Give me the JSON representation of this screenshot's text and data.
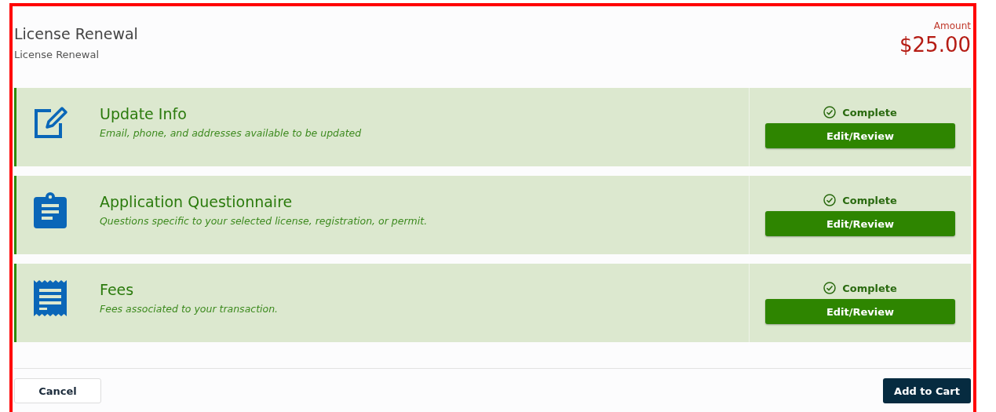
{
  "header": {
    "title": "License Renewal",
    "subtitle": "License Renewal",
    "amount_label": "Amount",
    "amount": "$25.00"
  },
  "steps": [
    {
      "kind": "edit",
      "title": "Update Info",
      "description": "Email, phone, and addresses available to be updated",
      "status": "Complete",
      "action": "Edit/Review"
    },
    {
      "kind": "clipboard",
      "title": "Application Questionnaire",
      "description": "Questions specific to your selected license, registration, or permit.",
      "status": "Complete",
      "action": "Edit/Review"
    },
    {
      "kind": "receipt",
      "title": "Fees",
      "description": "Fees associated to your transaction.",
      "status": "Complete",
      "action": "Edit/Review"
    }
  ],
  "footer": {
    "cancel": "Cancel",
    "submit": "Add to Cart"
  }
}
